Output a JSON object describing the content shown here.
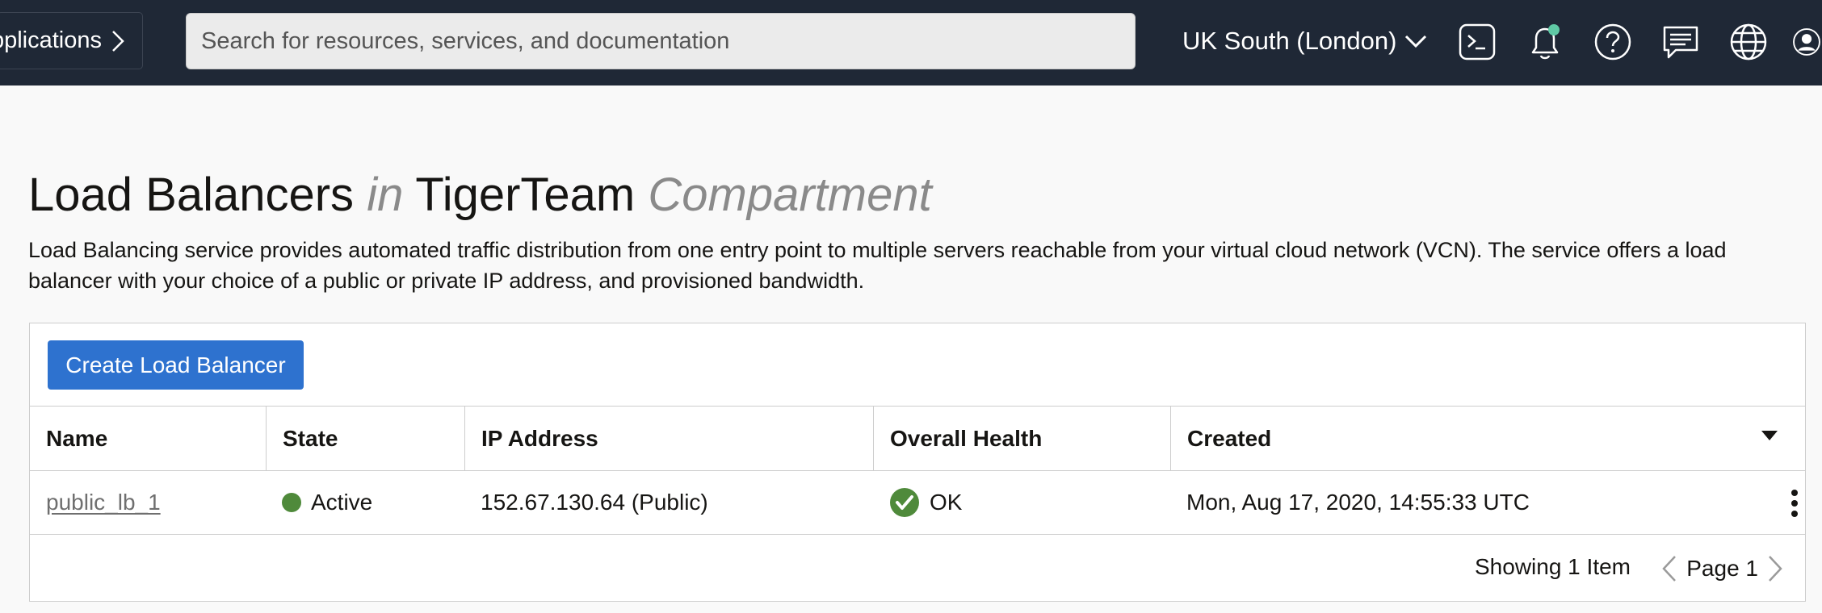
{
  "topbar": {
    "apps_label": "Applications",
    "search_placeholder": "Search for resources, services, and documentation",
    "region_label": "UK South (London)",
    "icons": [
      "cloud-shell-icon",
      "notifications-icon",
      "help-icon",
      "chat-icon",
      "language-icon",
      "profile-icon"
    ],
    "notification_dot_color": "#5fc9a5"
  },
  "page": {
    "title_part1": "Load Balancers",
    "title_in": "in",
    "title_compartment_name": "TigerTeam",
    "title_compartment_word": "Compartment",
    "description": "Load Balancing service provides automated traffic distribution from one entry point to multiple servers reachable from your virtual cloud network (VCN). The service offers a load balancer with your choice of a public or private IP address, and provisioned bandwidth."
  },
  "toolbar": {
    "create_label": "Create Load Balancer",
    "accent_color": "#2e72cf"
  },
  "table": {
    "columns": [
      "Name",
      "State",
      "IP Address",
      "Overall Health",
      "Created"
    ],
    "rows": [
      {
        "name": "public_lb_1",
        "state": "Active",
        "state_color": "#4f8a3b",
        "ip": "152.67.130.64 (Public)",
        "health": "OK",
        "health_color": "#4f8a3b",
        "created": "Mon, Aug 17, 2020, 14:55:33 UTC"
      }
    ]
  },
  "footer": {
    "showing": "Showing 1 Item",
    "page": "Page 1"
  }
}
